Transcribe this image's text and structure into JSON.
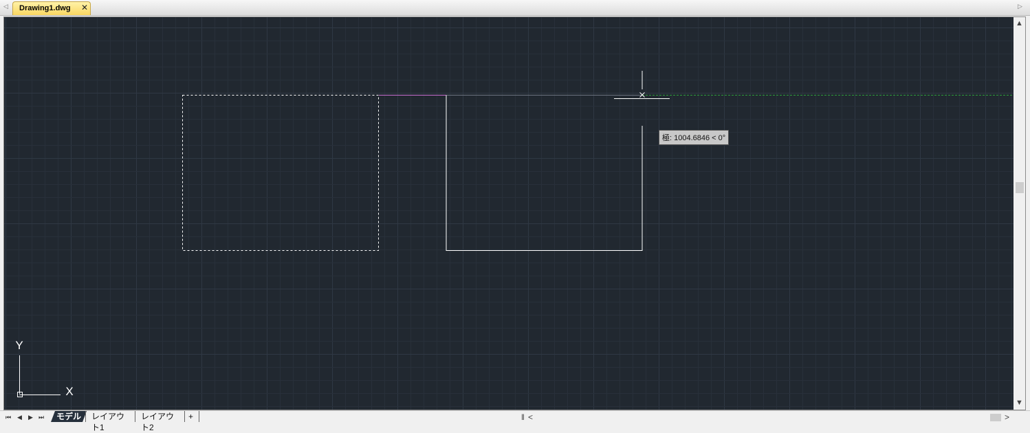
{
  "document_tab": {
    "label": "Drawing1.dwg",
    "close_glyph": "✕"
  },
  "tabstrip": {
    "left_arrow": "◁",
    "right_arrow": "▷"
  },
  "canvas": {
    "background_color": "#212830",
    "grid_minor_color": "#28303a",
    "grid_major_color": "#2f3844",
    "crosshair_color": "#ffffff",
    "tracking_line_color": "#2e9c3a",
    "polar_line_color": "#c86ed0"
  },
  "tooltip": {
    "text": "極: 1004.6846 < 0°"
  },
  "ucs": {
    "x_label": "X",
    "y_label": "Y"
  },
  "vertical_scrollbar": {
    "up": "▲",
    "down": "▼"
  },
  "bottom_bar": {
    "nav": [
      "⏮",
      "◀",
      "▶",
      "⏭"
    ],
    "tabs": [
      "モデル",
      "レイアウト1",
      "レイアウト2",
      "+"
    ],
    "active_tab": "モデル",
    "split_glyph": "‖",
    "scroll_left": "<",
    "scroll_right": ">"
  }
}
